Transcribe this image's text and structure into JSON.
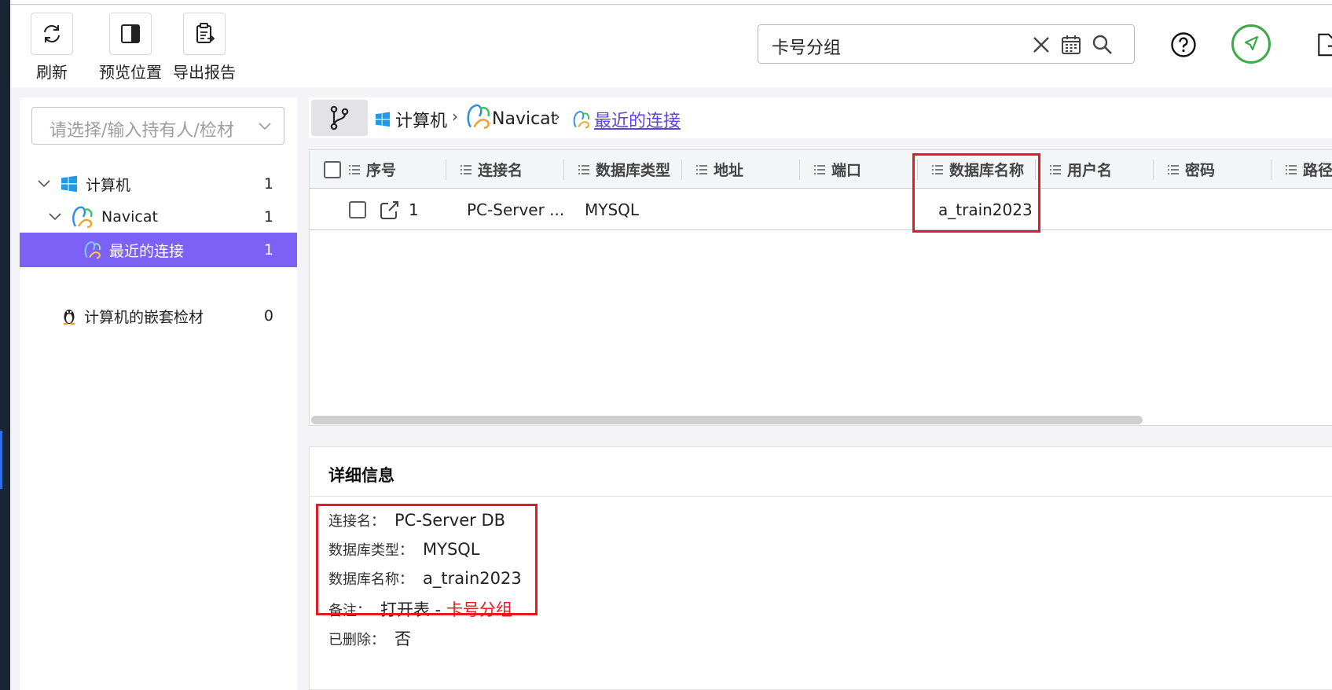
{
  "toolbar": {
    "refresh_label": "刷新",
    "preview_label": "预览位置",
    "export_label": "导出报告"
  },
  "search": {
    "value": "卡号分组"
  },
  "sidebar": {
    "select_placeholder": "请选择/输入持有人/检材",
    "items": [
      {
        "label": "计算机",
        "count": "1"
      },
      {
        "label": "Navicat",
        "count": "1"
      },
      {
        "label": "最近的连接",
        "count": "1"
      },
      {
        "label": "计算机的嵌套检材",
        "count": "0"
      }
    ]
  },
  "breadcrumb": {
    "items": [
      "计算机",
      "Navicat",
      "最近的连接"
    ],
    "separator": "›"
  },
  "grid": {
    "columns": [
      "序号",
      "连接名",
      "数据库类型",
      "地址",
      "端口",
      "数据库名称",
      "用户名",
      "密码",
      "路径"
    ],
    "rows": [
      {
        "index": "1",
        "conn_name": "PC-Server ...",
        "db_type": "MYSQL",
        "address": "",
        "port": "",
        "db_name": "a_train2023",
        "user": "",
        "password": "",
        "path": ""
      }
    ]
  },
  "detail": {
    "title": "详细信息",
    "fields": [
      {
        "key": "连接名：",
        "value": "PC-Server DB"
      },
      {
        "key": "数据库类型：",
        "value": "MYSQL"
      },
      {
        "key": "数据库名称：",
        "value": "a_train2023"
      },
      {
        "key": "备注：",
        "value": "打开表 - ",
        "value_red": "卡号分组"
      },
      {
        "key": "已删除：",
        "value": "否"
      }
    ]
  },
  "colors": {
    "accent": "#7b61f5",
    "link": "#5d45d6",
    "highlight": "#e31b23",
    "status_green": "#3daa4a"
  }
}
